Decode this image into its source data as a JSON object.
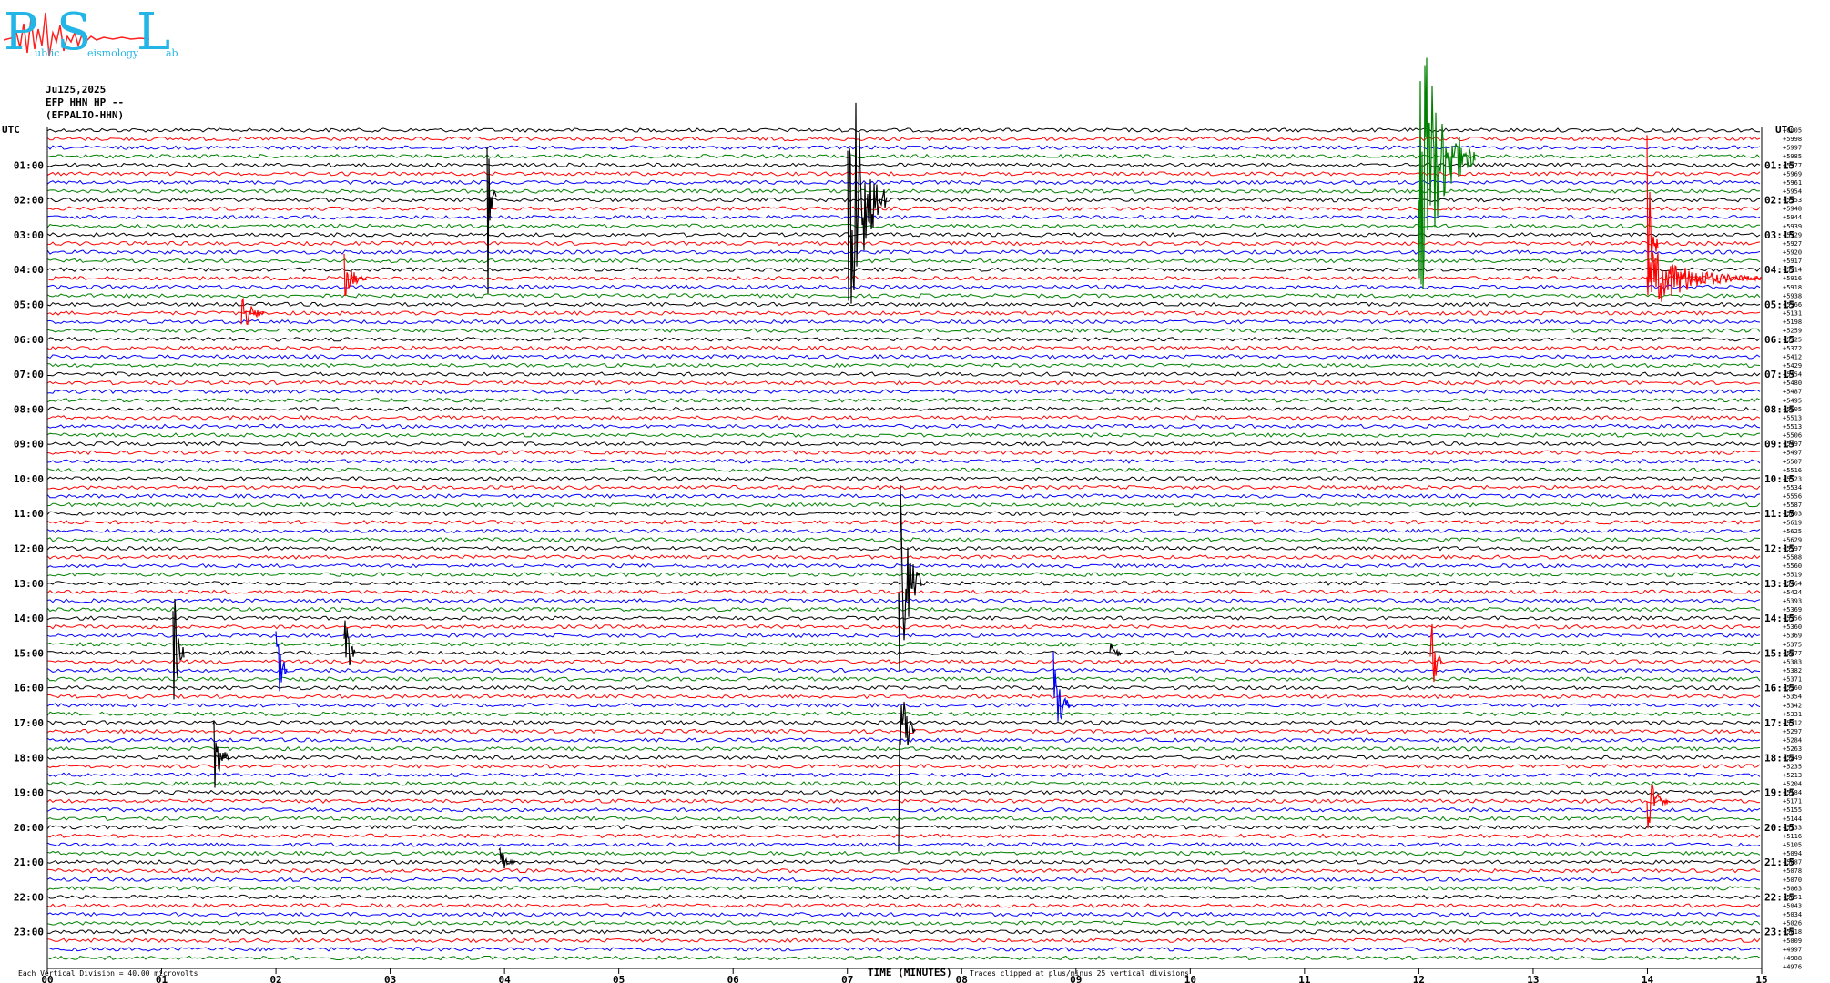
{
  "logo": {
    "letters": [
      "P",
      "S",
      "L"
    ],
    "small": [
      "ublic",
      "eismology",
      "ab"
    ]
  },
  "header": {
    "date": "Ju125,2025",
    "channel": "EFP HHN HP --",
    "station": "(EFPALIO-HHN)"
  },
  "chart_data": {
    "type": "line",
    "title": "",
    "xlabel": "TIME (MINUTES)",
    "xlim": [
      0,
      15
    ],
    "x_ticks": [
      "00",
      "01",
      "02",
      "03",
      "04",
      "05",
      "06",
      "07",
      "08",
      "09",
      "10",
      "11",
      "12",
      "13",
      "14",
      "15"
    ],
    "left_axis_label": "UTC",
    "right_axis_label": "UTC",
    "left_hour_labels": [
      "01:00",
      "02:00",
      "03:00",
      "04:00",
      "05:00",
      "06:00",
      "07:00",
      "08:00",
      "09:00",
      "10:00",
      "11:00",
      "12:00",
      "13:00",
      "14:00",
      "15:00",
      "16:00",
      "17:00",
      "18:00",
      "19:00",
      "20:00",
      "21:00",
      "22:00",
      "23:00"
    ],
    "right_hour_labels": [
      "01:15",
      "02:15",
      "03:15",
      "04:15",
      "05:15",
      "06:15",
      "07:15",
      "08:15",
      "09:15",
      "10:15",
      "11:15",
      "12:15",
      "13:15",
      "14:15",
      "15:15",
      "16:15",
      "17:15",
      "18:15",
      "19:15",
      "20:15",
      "21:15",
      "22:15",
      "23:15"
    ],
    "traces_per_hour": 4,
    "hours": 24,
    "trace_colors": [
      "#000000",
      "#ff0000",
      "#0000ff",
      "#008000"
    ],
    "right_offsets": [
      "+6005",
      "+5998",
      "+5997",
      "+5985",
      "+5977",
      "+5969",
      "+5961",
      "+5954",
      "+5953",
      "+5948",
      "+5944",
      "+5939",
      "+5929",
      "+5927",
      "+5920",
      "+5917",
      "+5914",
      "+5916",
      "+5918",
      "+5938",
      "+5966",
      "+5131",
      "+5198",
      "+5259",
      "+5325",
      "+5372",
      "+5412",
      "+5429",
      "+5454",
      "+5480",
      "+5487",
      "+5495",
      "+5505",
      "+5513",
      "+5513",
      "+5506",
      "+5497",
      "+5497",
      "+5507",
      "+5516",
      "+5523",
      "+5534",
      "+5556",
      "+5587",
      "+5603",
      "+5619",
      "+5625",
      "+5629",
      "+5597",
      "+5588",
      "+5560",
      "+5519",
      "+5464",
      "+5424",
      "+5393",
      "+5369",
      "+5356",
      "+5360",
      "+5369",
      "+5375",
      "+5377",
      "+5383",
      "+5382",
      "+5371",
      "+5360",
      "+5354",
      "+5342",
      "+5331",
      "+5312",
      "+5297",
      "+5284",
      "+5263",
      "+5249",
      "+5235",
      "+5213",
      "+5204",
      "+5184",
      "+5171",
      "+5155",
      "+5144",
      "+5133",
      "+5116",
      "+5105",
      "+5094",
      "+5087",
      "+5078",
      "+5070",
      "+5063",
      "+5051",
      "+5043",
      "+5034",
      "+5026",
      "+5018",
      "+5009",
      "+4997",
      "+4988",
      "+4976"
    ],
    "events": [
      {
        "minute": 3.85,
        "trace": 8,
        "amplitude": 30,
        "duration": 0.08
      },
      {
        "minute": 7.0,
        "trace": 8,
        "amplitude": 45,
        "duration": 0.35
      },
      {
        "minute": 12.0,
        "trace": 3,
        "amplitude": 40,
        "duration": 0.5
      },
      {
        "minute": 14.0,
        "trace": 13,
        "amplitude": 25,
        "duration": 0.1
      },
      {
        "minute": 14.0,
        "trace": 17,
        "amplitude": 8,
        "duration": 1.2
      },
      {
        "minute": 2.6,
        "trace": 17,
        "amplitude": 6,
        "duration": 0.2
      },
      {
        "minute": 1.7,
        "trace": 21,
        "amplitude": 6,
        "duration": 0.2
      },
      {
        "minute": 7.45,
        "trace": 52,
        "amplitude": 30,
        "duration": 0.2
      },
      {
        "minute": 1.1,
        "trace": 60,
        "amplitude": 20,
        "duration": 0.1
      },
      {
        "minute": 2.0,
        "trace": 62,
        "amplitude": 18,
        "duration": 0.1
      },
      {
        "minute": 2.6,
        "trace": 60,
        "amplitude": 14,
        "duration": 0.1
      },
      {
        "minute": 9.3,
        "trace": 60,
        "amplitude": 10,
        "duration": 0.1
      },
      {
        "minute": 12.1,
        "trace": 61,
        "amplitude": 14,
        "duration": 0.1
      },
      {
        "minute": 7.45,
        "trace": 68,
        "amplitude": 35,
        "duration": 0.15
      },
      {
        "minute": 8.8,
        "trace": 66,
        "amplitude": 14,
        "duration": 0.15
      },
      {
        "minute": 1.45,
        "trace": 72,
        "amplitude": 10,
        "duration": 0.15
      },
      {
        "minute": 14.0,
        "trace": 77,
        "amplitude": 8,
        "duration": 0.2
      },
      {
        "minute": 3.95,
        "trace": 84,
        "amplitude": 4,
        "duration": 0.15
      }
    ]
  },
  "footer": {
    "vertical_division": "Each Vertical Division =   40.00 microvolts",
    "clip_note": "Traces clipped at plus/minus 25 vertical divisions"
  }
}
